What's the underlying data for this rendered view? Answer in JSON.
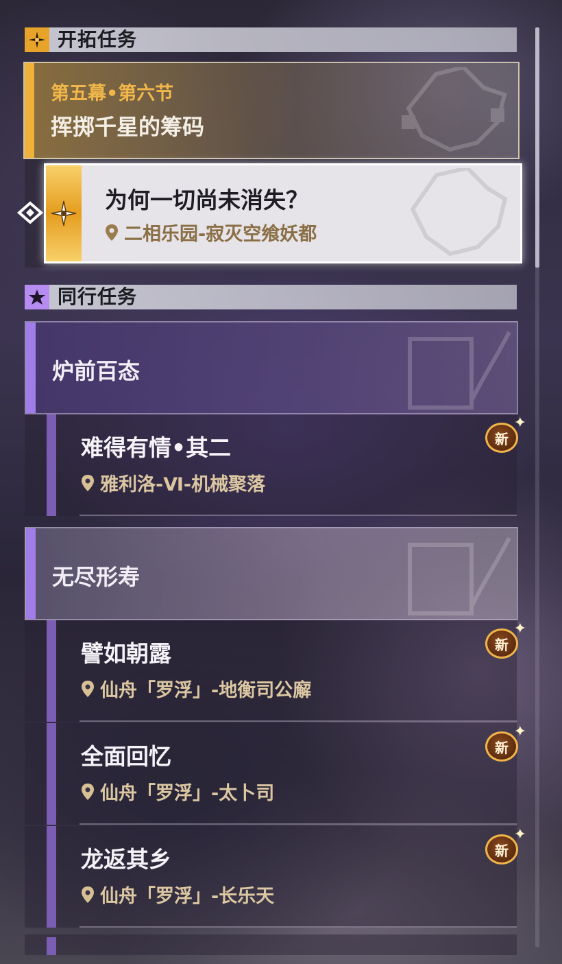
{
  "trailblaze": {
    "header": "开拓任务",
    "chapter": "第五幕•第六节",
    "chapter_title": "挥掷千星的筹码",
    "tracked_quest": {
      "title": "为何一切尚未消失？",
      "location": "二相乐园-寂灭空飨妖都"
    }
  },
  "companion": {
    "header": "同行任务",
    "groups": [
      {
        "name": "炉前百态",
        "quests": [
          {
            "title": "难得有情•其二",
            "location": "雅利洛-Ⅵ-机械聚落",
            "badge": "新"
          }
        ]
      },
      {
        "name": "无尽形寿",
        "quests": [
          {
            "title": "譬如朝露",
            "location": "仙舟「罗浮」-地衡司公廨",
            "badge": "新"
          },
          {
            "title": "全面回忆",
            "location": "仙舟「罗浮」-太卜司",
            "badge": "新"
          },
          {
            "title": "龙返其乡",
            "location": "仙舟「罗浮」-长乐天",
            "badge": "新"
          }
        ]
      }
    ]
  },
  "icons": {
    "trailblaze_badge": "compass-star-icon",
    "companion_badge": "star-icon",
    "tracked_pointer": "diamond-arrow-icon",
    "location": "map-pin-icon",
    "new": "new-badge-icon"
  },
  "colors": {
    "gold_accent": "#f0b13b",
    "purple_accent": "#a07de8",
    "quest_bar": "#7b5db3",
    "location_text": "#dcc7a2"
  }
}
